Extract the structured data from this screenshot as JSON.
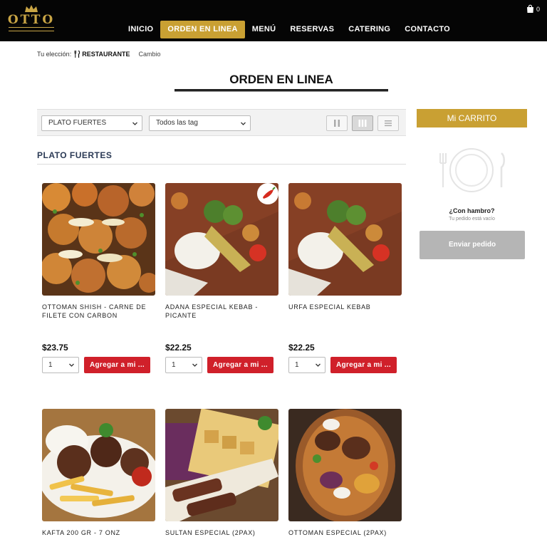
{
  "brand": {
    "logo_text": "OTTO",
    "accent": "#c9a033",
    "cta_red": "#d0202a"
  },
  "nav": {
    "items": [
      {
        "label": "INICIO"
      },
      {
        "label": "ORDEN EN LINEA",
        "active": true
      },
      {
        "label": "MENÚ"
      },
      {
        "label": "RESERVAS"
      },
      {
        "label": "CATERING"
      },
      {
        "label": "CONTACTO"
      }
    ],
    "cart_count": "0",
    "cart_icon": "shopping-bag-icon"
  },
  "selection": {
    "label": "Tu elección:",
    "value": "RESTAURANTE",
    "value_icon": "fork-knife-icon",
    "change": "Cambio"
  },
  "page": {
    "title": "ORDEN EN LINEA"
  },
  "filters": {
    "category": "PLATO FUERTES",
    "tag": "Todos las tag",
    "view_modes": [
      "two-column-icon",
      "three-column-icon",
      "list-icon"
    ],
    "active_view": "three-column-icon"
  },
  "section": {
    "title": "PLATO FUERTES"
  },
  "products": [
    {
      "name": "OTTOMAN SHISH - CARNE DE FILETE CON CARBON",
      "price": "$23.75",
      "qty": "1",
      "button": "Agregar a mi ...",
      "spicy": false
    },
    {
      "name": "ADANA ESPECIAL KEBAB - PICANTE",
      "price": "$22.25",
      "qty": "1",
      "button": "Agregar a mi ...",
      "spicy": true
    },
    {
      "name": "URFA ESPECIAL KEBAB",
      "price": "$22.25",
      "qty": "1",
      "button": "Agregar a mi ...",
      "spicy": false
    },
    {
      "name": "KAFTA 200 GR - 7 ONZ"
    },
    {
      "name": "SULTAN ESPECIAL (2PAX)"
    },
    {
      "name": "OTTOMAN ESPECIAL (2PAX)"
    }
  ],
  "cart": {
    "title": "Mi CARRITO",
    "hungry": "¿Con hambro?",
    "empty": "Tu pedido está vacío",
    "send": "Enviar pedido"
  }
}
